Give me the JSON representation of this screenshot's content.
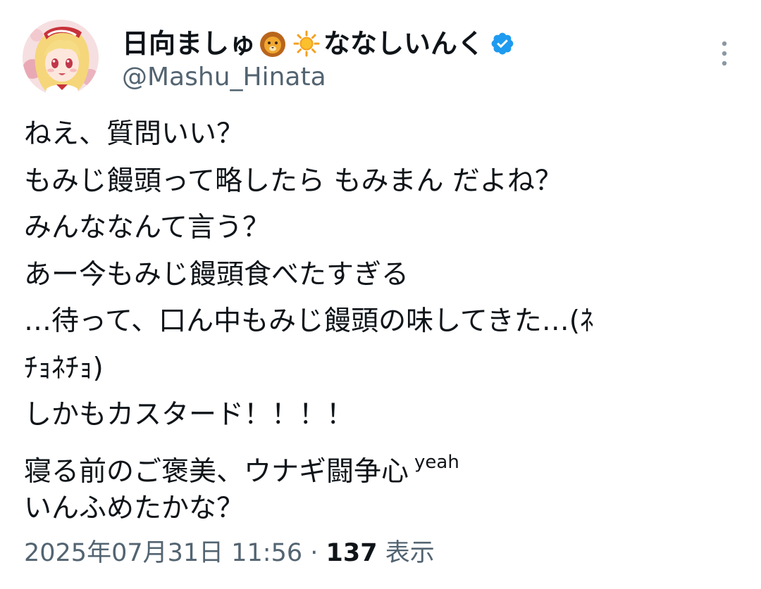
{
  "author": {
    "name_part1": "日向ましゅ",
    "name_part2": "ななしいんく",
    "emoji_1": "lion-emoji",
    "emoji_2": "sun-emoji",
    "verified_icon": "verified-badge-icon",
    "handle": "@Mashu_Hinata",
    "avatar": "avatar-anime-girl-blonde"
  },
  "more_icon": "more-vertical-icon",
  "tweet": {
    "lines": [
      "ねえ、質問いい？",
      "もみじ饅頭って略したら もみまん だよね？",
      " みんななんて言う？",
      "あー今もみじ饅頭食べたすぎる",
      "…待って、口ん中もみじ饅頭の味してきた…(ﾈ",
      "ﾁｮﾈﾁｮ)",
      " しかもカスタード！！！！",
      "寝る前のご褒美、ウナギ闘争心",
      "いんふめたかな？"
    ],
    "line8_suffix": "yeah"
  },
  "meta": {
    "timestamp": "2025年07月31日 11:56",
    "separator": " · ",
    "views_count": "137",
    "views_label": " 表示"
  },
  "colors": {
    "text": "#0f1419",
    "secondary": "#536471",
    "verified": "#1d9bf0"
  }
}
